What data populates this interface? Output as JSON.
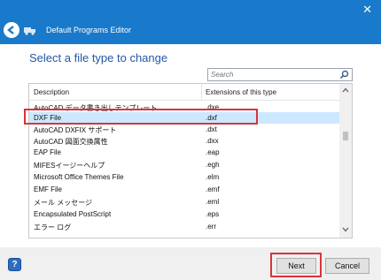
{
  "window": {
    "title": "Default Programs Editor",
    "close_glyph": "✕"
  },
  "heading": "Select a file type to change",
  "search": {
    "placeholder": "Search",
    "value": ""
  },
  "table": {
    "columns": [
      "Description",
      "Extensions of this type"
    ],
    "rows": [
      {
        "description": "AutoCAD データ書き出しテンプレート",
        "extension": ".dxe"
      },
      {
        "description": "DXF File",
        "extension": ".dxf",
        "selected": true
      },
      {
        "description": "AutoCAD DXFIX サポート",
        "extension": ".dxt"
      },
      {
        "description": "AutoCAD 図面交換属性",
        "extension": ".dxx"
      },
      {
        "description": "EAP File",
        "extension": ".eap"
      },
      {
        "description": "MIFESイージーヘルプ",
        "extension": ".egh"
      },
      {
        "description": "Microsoft Office Themes File",
        "extension": ".elm"
      },
      {
        "description": "EMF File",
        "extension": ".emf"
      },
      {
        "description": "メール メッセージ",
        "extension": ".eml"
      },
      {
        "description": "Encapsulated PostScript",
        "extension": ".eps"
      },
      {
        "description": "エラー ログ",
        "extension": ".err"
      }
    ]
  },
  "buttons": {
    "help": "?",
    "next": "Next",
    "cancel": "Cancel"
  },
  "colors": {
    "titlebar": "#1979ca",
    "heading": "#2456a8",
    "selection": "#cce8ff",
    "highlight_box": "#d9343a"
  }
}
